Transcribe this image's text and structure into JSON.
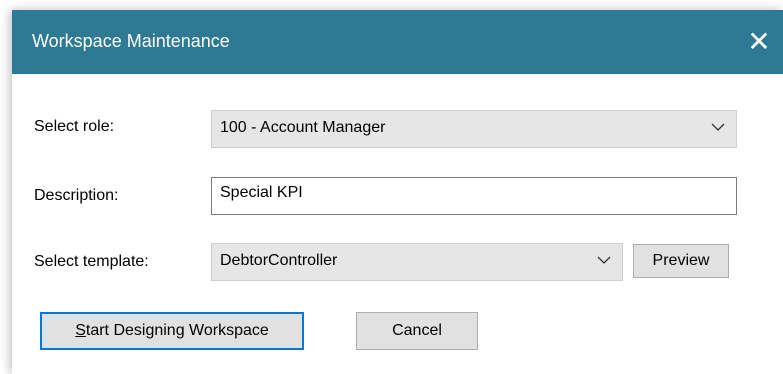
{
  "window": {
    "title": "Workspace Maintenance",
    "close_glyph": "✕",
    "close_icon": "close-icon"
  },
  "form": {
    "role_label": "Select role:",
    "role_value": "100 - Account Manager",
    "description_label": "Description:",
    "description_value": "Special KPI",
    "template_label": "Select template:",
    "template_value": "DebtorController"
  },
  "buttons": {
    "preview": "Preview",
    "start_mnemonic": "S",
    "start_rest": "tart Designing Workspace",
    "cancel": "Cancel"
  },
  "colors": {
    "titlebar": "#2e7a94",
    "focus_border": "#0078d7"
  }
}
